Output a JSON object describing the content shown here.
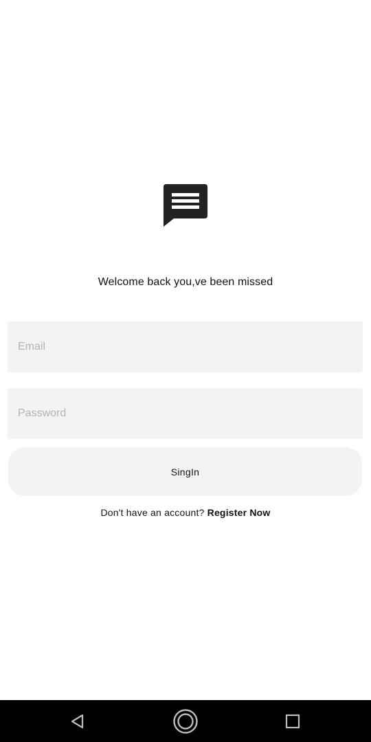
{
  "welcome_text": "Welcome back you,ve been missed",
  "form": {
    "email_placeholder": "Email",
    "email_value": "",
    "password_placeholder": "Password",
    "password_value": "",
    "signin_label": "SingIn"
  },
  "register": {
    "prompt": "Don't have an account?",
    "link_label": "Register Now"
  },
  "icons": {
    "logo": "message-icon",
    "back": "back-icon",
    "home": "home-icon",
    "recents": "recents-icon"
  },
  "colors": {
    "background": "#ffffff",
    "field_background": "#f3f3f3",
    "placeholder": "#b3b3b3",
    "text": "#111111",
    "navbar": "#000000",
    "logo": "#222222"
  }
}
